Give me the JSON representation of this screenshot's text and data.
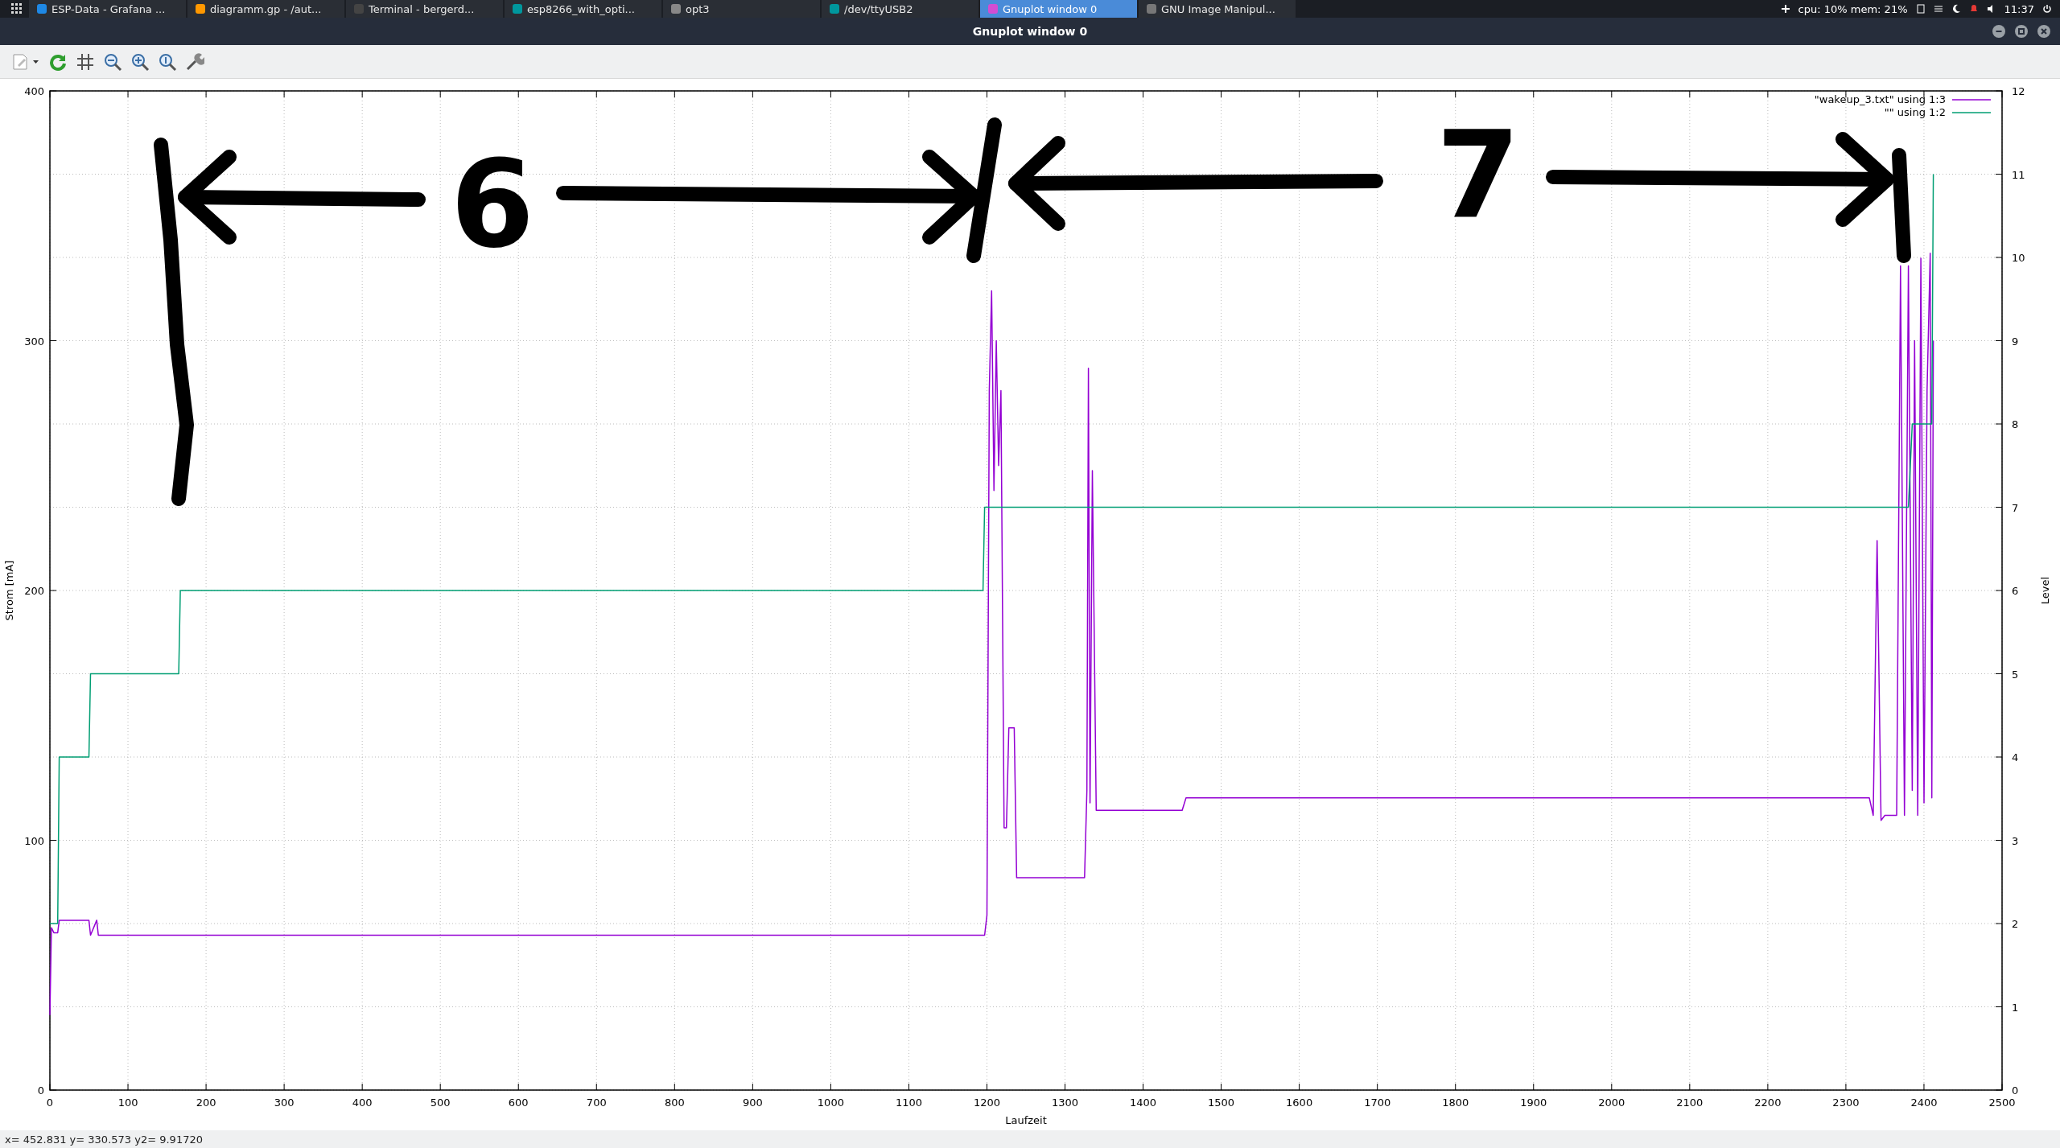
{
  "taskbar": {
    "tasks": [
      {
        "label": "ESP-Data - Grafana ...",
        "selected": false
      },
      {
        "label": "diagramm.gp - /aut...",
        "selected": false
      },
      {
        "label": "Terminal - bergerd...",
        "selected": false
      },
      {
        "label": "esp8266_with_opti...",
        "selected": false
      },
      {
        "label": "opt3",
        "selected": false
      },
      {
        "label": "/dev/ttyUSB2",
        "selected": false
      },
      {
        "label": "Gnuplot window 0",
        "selected": true
      },
      {
        "label": "GNU Image Manipul...",
        "selected": false
      }
    ],
    "status": "cpu: 10% mem: 21%",
    "time": "11:37"
  },
  "window": {
    "title": "Gnuplot window 0"
  },
  "plot": {
    "chart_data": {
      "type": "line",
      "xlabel": "Laufzeit",
      "ylabel": "Strom [mA]",
      "y2label": "Level",
      "xlim": [
        0,
        2500
      ],
      "ylim": [
        0,
        400
      ],
      "y2lim": [
        0,
        12
      ],
      "xticks": [
        0,
        100,
        200,
        300,
        400,
        500,
        600,
        700,
        800,
        900,
        1000,
        1100,
        1200,
        1300,
        1400,
        1500,
        1600,
        1700,
        1800,
        1900,
        2000,
        2100,
        2200,
        2300,
        2400,
        2500
      ],
      "yticks": [
        0,
        100,
        200,
        300,
        400
      ],
      "y2ticks": [
        0,
        1,
        2,
        3,
        4,
        5,
        6,
        7,
        8,
        9,
        10,
        11,
        12
      ],
      "x": [
        0,
        2,
        5,
        10,
        12,
        50,
        52,
        60,
        62,
        165,
        167,
        1195,
        1197,
        1200,
        1203,
        1206,
        1209,
        1212,
        1215,
        1218,
        1222,
        1225,
        1228,
        1235,
        1238,
        1240,
        1325,
        1328,
        1330,
        1332,
        1335,
        1340,
        1450,
        1455,
        2330,
        2335,
        2340,
        2345,
        2350,
        2355,
        2360,
        2365,
        2370,
        2375,
        2380,
        2385,
        2388,
        2392,
        2396,
        2400,
        2404,
        2408,
        2410,
        2412
      ],
      "series": [
        {
          "name": "\"wakeup_3.txt\" using 1:3",
          "color": "#9400d3",
          "axis": "y",
          "values": [
            30,
            65,
            63,
            63,
            68,
            68,
            62,
            68,
            62,
            62,
            62,
            62,
            62,
            70,
            280,
            320,
            240,
            300,
            250,
            280,
            105,
            105,
            145,
            145,
            85,
            85,
            85,
            120,
            289,
            115,
            248,
            112,
            112,
            117,
            117,
            110,
            220,
            108,
            110,
            110,
            110,
            110,
            330,
            110,
            330,
            120,
            300,
            110,
            333,
            115,
            280,
            335,
            117,
            300
          ]
        },
        {
          "name": "\"\" using 1:2",
          "color": "#009e73",
          "axis": "y2",
          "values": [
            2,
            2,
            2,
            2,
            4,
            4,
            5,
            5,
            5,
            5,
            6,
            6,
            7,
            7,
            7,
            7,
            7,
            7,
            7,
            7,
            7,
            7,
            7,
            7,
            7,
            7,
            7,
            7,
            7,
            7,
            7,
            7,
            7,
            7,
            7,
            7,
            7,
            7,
            7,
            7,
            7,
            7,
            7,
            7,
            7,
            8,
            8,
            8,
            8,
            8,
            8,
            8,
            8,
            11
          ]
        }
      ],
      "grid": true,
      "legend": true,
      "annotations": [
        "6",
        "7"
      ]
    }
  },
  "status_bar": "x= 452.831 y= 330.573 y2= 9.91720"
}
